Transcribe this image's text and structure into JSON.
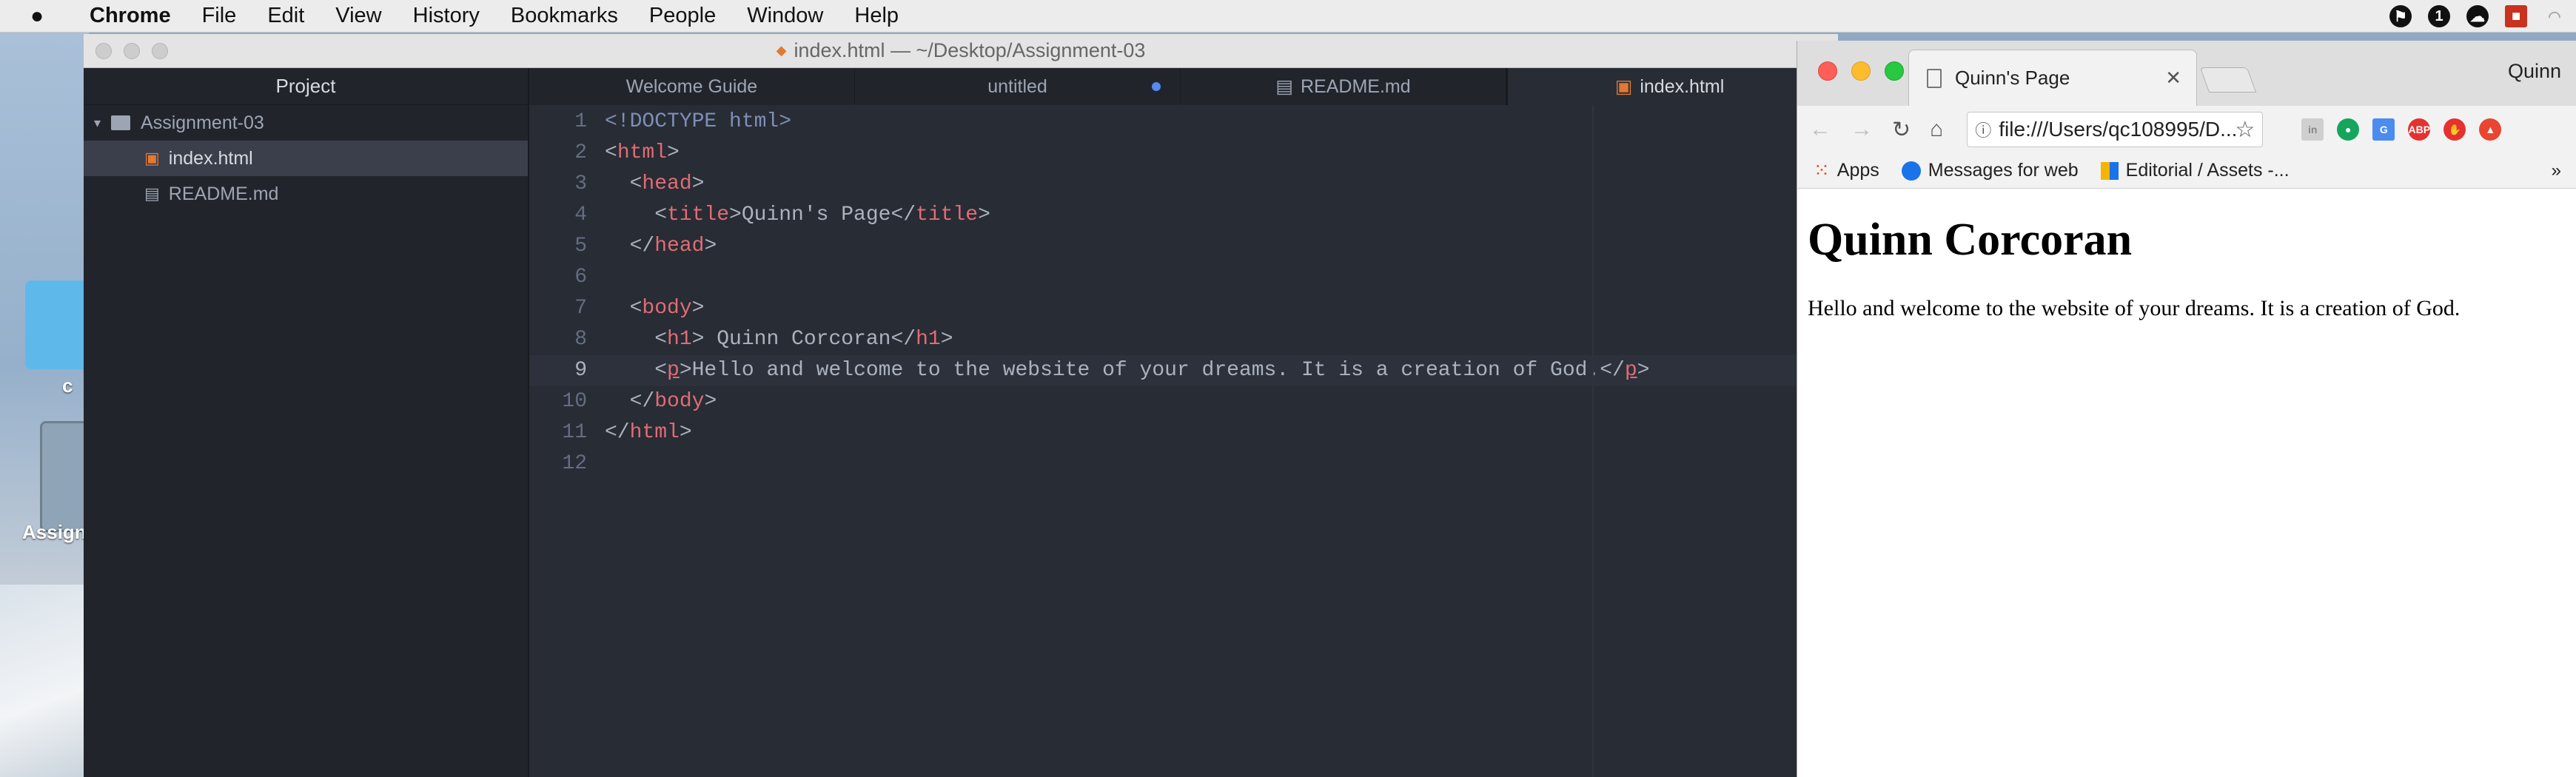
{
  "menubar": {
    "app": "Chrome",
    "items": [
      "File",
      "Edit",
      "View",
      "History",
      "Bookmarks",
      "People",
      "Window",
      "Help"
    ]
  },
  "desktop": {
    "labels": [
      "c",
      "Assign"
    ]
  },
  "atom": {
    "title": "index.html — ~/Desktop/Assignment-03",
    "tree": {
      "header": "Project",
      "folder": "Assignment-03",
      "files": [
        "index.html",
        "README.md"
      ]
    },
    "tabs": [
      "Welcome Guide",
      "untitled",
      "README.md",
      "index.html"
    ],
    "lines": [
      "1",
      "2",
      "3",
      "4",
      "5",
      "6",
      "7",
      "8",
      "9",
      "10",
      "11",
      "12"
    ]
  },
  "chrome": {
    "tab_title": "Quinn's Page",
    "user": "Quinn",
    "url": "file:///Users/qc108995/D...",
    "bookmarks": [
      "Apps",
      "Messages for web",
      "Editorial / Assets -..."
    ],
    "page": {
      "heading": "Quinn Corcoran",
      "body": "Hello and welcome to the website of your dreams. It is a creation of God."
    }
  },
  "colors": {
    "editor_bg": "#282c34",
    "tag": "#e06c75",
    "doctype": "#7e8fb6",
    "modified_dot": "#568af2"
  }
}
